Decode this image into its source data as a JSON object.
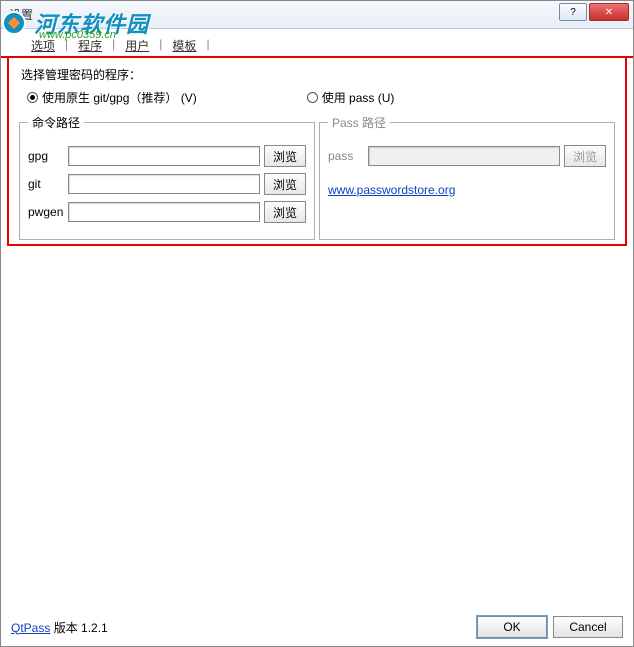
{
  "window": {
    "title": "设置",
    "help_symbol": "?",
    "close_symbol": "✕"
  },
  "watermark": {
    "text": "河东软件园",
    "sub": "www.pc0359.cn"
  },
  "tabs": {
    "t0": "选项",
    "t1": "程序",
    "t2": "用户",
    "t3": "模板"
  },
  "section": {
    "header": "选择管理密码的程序：",
    "radio_native": "使用原生 git/gpg（推荐）  (V)",
    "radio_pass": "使用 pass  (U)"
  },
  "groupbox_left": {
    "legend": "命令路径",
    "gpg_label": "gpg",
    "git_label": "git",
    "pwgen_label": "pwgen",
    "browse": "浏览"
  },
  "groupbox_right": {
    "legend": "Pass 路径",
    "pass_label": "pass",
    "browse": "浏览",
    "link": "www.passwordstore.org"
  },
  "footer": {
    "qtpass": "QtPass",
    "version_label": " 版本 1.2.1",
    "ok": "OK",
    "cancel": "Cancel"
  }
}
